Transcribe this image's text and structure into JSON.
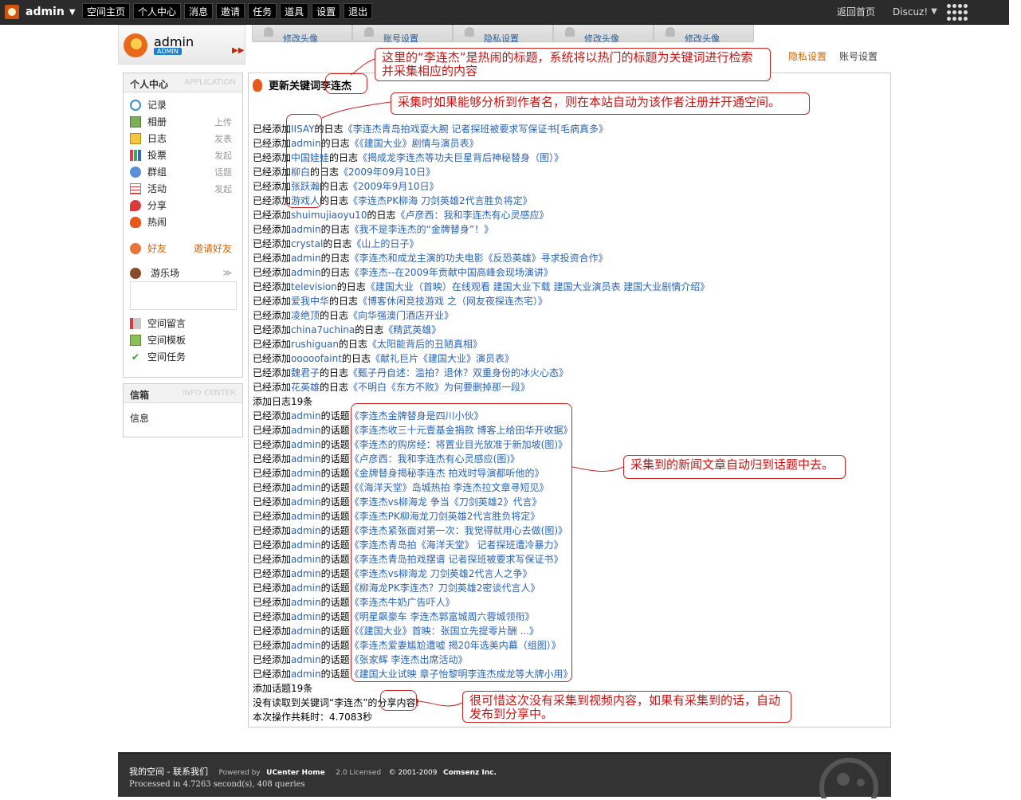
{
  "topbar": {
    "brand": "admin",
    "nav": [
      "空间主页",
      "个人中心",
      "消息",
      "邀请",
      "任务",
      "道具",
      "设置",
      "退出"
    ],
    "back_home": "返回首页",
    "discuz": "Discuz!"
  },
  "header": {
    "username": "admin",
    "badge": "ADMIN",
    "tabs": [
      "修改头像",
      "账号设置",
      "隐私设置",
      "修改头像",
      "修改头像"
    ],
    "links": [
      "隐私设置",
      "账号设置"
    ]
  },
  "sidebar": {
    "title": "个人中心",
    "title_en": "APPLICATION",
    "items": [
      {
        "label": "记录",
        "extra": ""
      },
      {
        "label": "相册",
        "extra": "上传"
      },
      {
        "label": "日志",
        "extra": "发表"
      },
      {
        "label": "投票",
        "extra": "发起"
      },
      {
        "label": "群组",
        "extra": "话题"
      },
      {
        "label": "活动",
        "extra": "发起"
      },
      {
        "label": "分享",
        "extra": ""
      },
      {
        "label": "热闹",
        "extra": ""
      }
    ],
    "friends": "好友",
    "invite": "邀请好友",
    "playground": "游乐场",
    "links": [
      "空间留言",
      "空间模板",
      "空间任务"
    ],
    "info_title": "信箱",
    "info_title_en": "INFO CENTER",
    "info_item": "信息"
  },
  "main": {
    "title_prefix": "更新关键词",
    "keyword": "李连杰",
    "prefix": "已经添加",
    "blog_suffix": "的日志",
    "topic_suffix": "的话题",
    "blogs": [
      {
        "author": "IISAY",
        "title": "《李连杰青岛拍戏耍大腕 记者探班被要求写保证书[毛病真多》"
      },
      {
        "author": "admin",
        "title": "《《建国大业》剧情与演员表》"
      },
      {
        "author": "中国娃娃",
        "title": "《揭成龙李连杰等功夫巨星背后神秘替身（图）》"
      },
      {
        "author": "柳白",
        "title": "《2009年09月10日》"
      },
      {
        "author": "张跃瀚",
        "title": "《2009年9月10日》"
      },
      {
        "author": "游戏人",
        "title": "《李连杰PK柳海 刀剑英雄2代言胜负将定》"
      },
      {
        "author": "shuimujiaoyu10",
        "title": "《卢彦西：我和李连杰有心灵感应》"
      },
      {
        "author": "admin",
        "title": "《我不是李连杰的“金牌替身”！》"
      },
      {
        "author": "crystal",
        "title": "《山上的日子》"
      },
      {
        "author": "admin",
        "title": "《李连杰和成龙主演的功夫电影《反恐英雄》寻求投资合作》"
      },
      {
        "author": "admin",
        "title": "《李连杰--在2009年贡献中国高峰会现场演讲》"
      },
      {
        "author": "television",
        "title": "《建国大业（首映）在线观看 建国大业下载 建国大业演员表 建国大业剧情介绍》"
      },
      {
        "author": "爱我中华",
        "title": "《博客休闲竞技游戏 之（网友夜探连杰宅）》"
      },
      {
        "author": "凌绝顶",
        "title": "《向华强澳门酒店开业》"
      },
      {
        "author": "china7uchina",
        "title": "《精武英雄》"
      },
      {
        "author": "rushiguan",
        "title": "《太阳能背后的丑陋真相》"
      },
      {
        "author": "ooooofaint",
        "title": "《献礼巨片《建国大业》演员表》"
      },
      {
        "author": "魏君子",
        "title": "《甄子丹自述：滥拍？退休？双重身份的冰火心态》"
      },
      {
        "author": "花英雄",
        "title": "《不明白《东方不败》为何要删掉那一段》"
      }
    ],
    "blog_total": "添加日志19条",
    "topics": [
      "《李连杰金牌替身是四川小伙》",
      "《李连杰收三十元壹基金捐款 博客上给田华开收据》",
      "《李连杰的购房经：将置业目光放准于新加坡(图)》",
      "《卢彦西：我和李连杰有心灵感应(图)》",
      "《金牌替身揭秘李连杰 拍戏时导演都听他的》",
      "《《海洋天堂》岛城热拍 李连杰拉文章寻短见》",
      "《李连杰vs柳海龙 争当《刀剑英雄2》代言》",
      "《李连杰PK柳海龙刀剑英雄2代言胜负将定》",
      "《李连杰紧张面对第一次：我觉得就用心去做(图)》",
      "《李连杰青岛拍《海洋天堂》 记者探班遭冷暴力》",
      "《李连杰青岛拍戏摆谱 记者探班被要求写保证书》",
      "《李连杰vs柳海龙 刀剑英雄2代言人之争》",
      "《柳海龙PK李连杰？刀剑英雄2密谈代言人》",
      "《李连杰牛奶广告吓人》",
      "《明星飙豪车 李连杰郭富城周六蓉城领衔》",
      "《《建国大业》首映：张国立先提零片酬 ...》",
      "《李连杰爱妻尴尬遭嘘 揭20年选美内幕（组图）》",
      "《张家辉 李连杰出席活动》",
      "《建国大业试映 章子怡黎明李连杰成龙等大牌小用》"
    ],
    "topic_author": "admin",
    "topic_total": "添加话题19条",
    "share_prefix": "没有读取到关键词“李连杰”的",
    "share_word": "分享",
    "share_suffix": "内容!",
    "time_text": "本次操作共耗时：4.7083秒"
  },
  "annotations": {
    "keyword_note": "这里的“李连杰”是热闹的标题，系统将以热门的标题为关键词进行检索并采集相应的内容",
    "author_note": "采集时如果能够分析到作者名，则在本站自动为该作者注册并开通空间。",
    "topic_note": "采集到的新闻文章自动归到话题中去。",
    "share_note": "很可惜这次没有采集到视频内容，如果有采集到的话，自动发布到分享中。"
  },
  "footer": {
    "links": "我的空间 - 联系我们",
    "powered": "Powered by",
    "product": "UCenter Home",
    "version": "2.0 Licensed",
    "copyright": "© 2001-2009",
    "company": "Comsenz Inc.",
    "processed": "Processed in 4.7263 second(s), 408 queries"
  },
  "colors": {
    "link": "#2a63b5",
    "accent": "#d86300",
    "annotation": "#cc1111",
    "topbar": "#2b2b2b",
    "footer": "#333333"
  }
}
